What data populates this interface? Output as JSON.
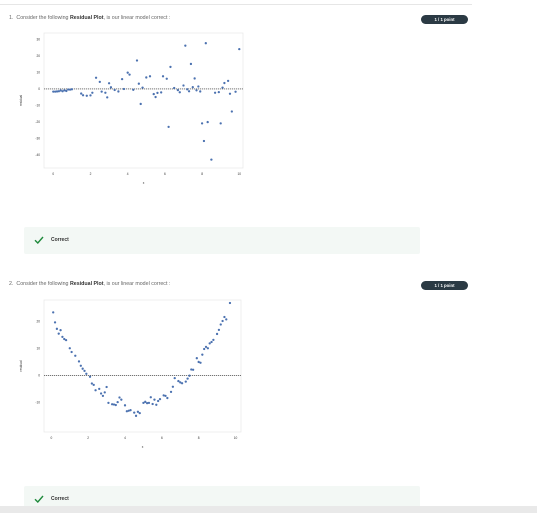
{
  "questions": [
    {
      "number": "1.",
      "prefix": "Consider the following ",
      "bold": "Residual Plot",
      "suffix": ", is our linear model correct :",
      "points": "1 / 1 point",
      "feedback": "Correct"
    },
    {
      "number": "2.",
      "prefix": "Consider the following ",
      "bold": "Residual Plot",
      "suffix": ", is our linear model correct :",
      "points": "1 / 1 point",
      "feedback": "Correct"
    }
  ],
  "colors": {
    "marker": "#4c72b0",
    "badge": "#2b3a44",
    "correct": "#1f8a3c",
    "feedback_bg": "#f3f8f5"
  },
  "chart_data": [
    {
      "type": "scatter",
      "xlabel": "x",
      "ylabel": "residual",
      "xlim": [
        -0.5,
        10.2
      ],
      "ylim": [
        -48,
        34
      ],
      "xticks": [
        "0",
        "2",
        "4",
        "6",
        "8",
        "10"
      ],
      "yticks": [
        "30",
        "20",
        "10",
        "0",
        "-10",
        "-20",
        "-30",
        "-40"
      ],
      "reference_line": 0,
      "points": [
        [
          0.0,
          -1.6
        ],
        [
          0.1,
          -1.6
        ],
        [
          0.2,
          -1.5
        ],
        [
          0.3,
          -1.4
        ],
        [
          0.4,
          -0.9
        ],
        [
          0.5,
          -1.4
        ],
        [
          0.6,
          -0.8
        ],
        [
          0.7,
          -1.2
        ],
        [
          0.8,
          -0.3
        ],
        [
          0.9,
          -0.4
        ],
        [
          1.0,
          -0.2
        ],
        [
          1.5,
          -2.8
        ],
        [
          1.6,
          -3.8
        ],
        [
          1.8,
          -4.1
        ],
        [
          2.0,
          -3.9
        ],
        [
          2.1,
          -2.3
        ],
        [
          2.3,
          6.8
        ],
        [
          2.5,
          4.3
        ],
        [
          2.6,
          -1.6
        ],
        [
          2.8,
          -2.3
        ],
        [
          2.9,
          -5.1
        ],
        [
          3.0,
          3.5
        ],
        [
          3.1,
          1.0
        ],
        [
          3.3,
          -0.6
        ],
        [
          3.5,
          -1.5
        ],
        [
          3.7,
          6.0
        ],
        [
          3.8,
          0.0
        ],
        [
          4.0,
          9.9
        ],
        [
          4.1,
          8.7
        ],
        [
          4.3,
          -0.5
        ],
        [
          4.5,
          17.3
        ],
        [
          4.6,
          3.2
        ],
        [
          4.7,
          -9.1
        ],
        [
          4.8,
          0.8
        ],
        [
          5.0,
          7.0
        ],
        [
          5.2,
          7.7
        ],
        [
          5.4,
          -3.1
        ],
        [
          5.5,
          -4.9
        ],
        [
          5.6,
          -2.4
        ],
        [
          5.8,
          -2.1
        ],
        [
          5.9,
          7.7
        ],
        [
          6.1,
          6.2
        ],
        [
          6.2,
          -23.0
        ],
        [
          6.3,
          13.4
        ],
        [
          6.5,
          0.6
        ],
        [
          6.7,
          -0.7
        ],
        [
          6.8,
          -2.0
        ],
        [
          7.0,
          2.1
        ],
        [
          7.1,
          26.3
        ],
        [
          7.2,
          -0.2
        ],
        [
          7.3,
          -1.4
        ],
        [
          7.4,
          15.2
        ],
        [
          7.5,
          1.1
        ],
        [
          7.6,
          6.4
        ],
        [
          7.7,
          -0.8
        ],
        [
          7.8,
          1.5
        ],
        [
          7.9,
          -1.5
        ],
        [
          8.0,
          -20.9
        ],
        [
          8.1,
          -31.6
        ],
        [
          8.2,
          27.8
        ],
        [
          8.3,
          -20.1
        ],
        [
          8.5,
          -42.9
        ],
        [
          8.7,
          -2.3
        ],
        [
          8.9,
          -1.9
        ],
        [
          9.0,
          -20.9
        ],
        [
          9.1,
          0.8
        ],
        [
          9.2,
          3.6
        ],
        [
          9.4,
          4.9
        ],
        [
          9.5,
          -2.9
        ],
        [
          9.6,
          -13.7
        ],
        [
          9.8,
          -1.7
        ],
        [
          10.0,
          24.2
        ]
      ]
    },
    {
      "type": "scatter",
      "xlabel": "x",
      "ylabel": "residual",
      "xlim": [
        -0.4,
        10.3
      ],
      "ylim": [
        -21,
        28
      ],
      "xticks": [
        "0",
        "2",
        "4",
        "6",
        "8",
        "10"
      ],
      "yticks": [
        "20",
        "10",
        "0",
        "-10"
      ],
      "reference_line": 0,
      "points": [
        [
          0.1,
          23.4
        ],
        [
          0.2,
          19.7
        ],
        [
          0.3,
          17.3
        ],
        [
          0.4,
          15.5
        ],
        [
          0.5,
          16.8
        ],
        [
          0.6,
          14.3
        ],
        [
          0.7,
          13.5
        ],
        [
          0.8,
          13.1
        ],
        [
          1.0,
          10.1
        ],
        [
          1.1,
          8.7
        ],
        [
          1.3,
          7.3
        ],
        [
          1.5,
          5.2
        ],
        [
          1.6,
          3.6
        ],
        [
          1.7,
          2.5
        ],
        [
          1.8,
          1.7
        ],
        [
          1.9,
          0.6
        ],
        [
          2.1,
          -0.5
        ],
        [
          2.2,
          -3.0
        ],
        [
          2.3,
          -3.5
        ],
        [
          2.4,
          -5.5
        ],
        [
          2.6,
          -5.0
        ],
        [
          2.7,
          -6.7
        ],
        [
          2.8,
          -7.6
        ],
        [
          2.9,
          -6.3
        ],
        [
          3.0,
          -4.3
        ],
        [
          3.1,
          -10.2
        ],
        [
          3.3,
          -10.7
        ],
        [
          3.4,
          -10.8
        ],
        [
          3.5,
          -11.0
        ],
        [
          3.6,
          -9.9
        ],
        [
          3.7,
          -8.2
        ],
        [
          3.8,
          -9.0
        ],
        [
          4.0,
          -11.1
        ],
        [
          4.1,
          -13.3
        ],
        [
          4.2,
          -13.1
        ],
        [
          4.3,
          -12.9
        ],
        [
          4.5,
          -13.8
        ],
        [
          4.6,
          -15.0
        ],
        [
          4.7,
          -13.5
        ],
        [
          4.8,
          -14.0
        ],
        [
          5.0,
          -10.2
        ],
        [
          5.1,
          -9.8
        ],
        [
          5.2,
          -10.3
        ],
        [
          5.3,
          -10.2
        ],
        [
          5.4,
          -8.1
        ],
        [
          5.5,
          -10.6
        ],
        [
          5.6,
          -9.0
        ],
        [
          5.7,
          -10.9
        ],
        [
          5.8,
          -9.5
        ],
        [
          5.9,
          -8.8
        ],
        [
          6.1,
          -7.4
        ],
        [
          6.2,
          -7.6
        ],
        [
          6.3,
          -8.4
        ],
        [
          6.5,
          -6.1
        ],
        [
          6.6,
          -4.2
        ],
        [
          6.7,
          -1.0
        ],
        [
          6.9,
          -2.1
        ],
        [
          7.0,
          -2.6
        ],
        [
          7.1,
          -2.9
        ],
        [
          7.3,
          -2.3
        ],
        [
          7.4,
          -1.2
        ],
        [
          7.5,
          -0.1
        ],
        [
          7.6,
          2.2
        ],
        [
          7.7,
          2.1
        ],
        [
          7.9,
          6.4
        ],
        [
          8.0,
          5.0
        ],
        [
          8.1,
          4.7
        ],
        [
          8.2,
          7.7
        ],
        [
          8.3,
          9.8
        ],
        [
          8.4,
          10.6
        ],
        [
          8.5,
          10.1
        ],
        [
          8.6,
          11.9
        ],
        [
          8.7,
          12.4
        ],
        [
          8.8,
          13.2
        ],
        [
          9.0,
          15.4
        ],
        [
          9.1,
          16.9
        ],
        [
          9.2,
          18.9
        ],
        [
          9.3,
          20.2
        ],
        [
          9.4,
          21.7
        ],
        [
          9.5,
          20.8
        ],
        [
          9.7,
          26.9
        ]
      ]
    }
  ]
}
